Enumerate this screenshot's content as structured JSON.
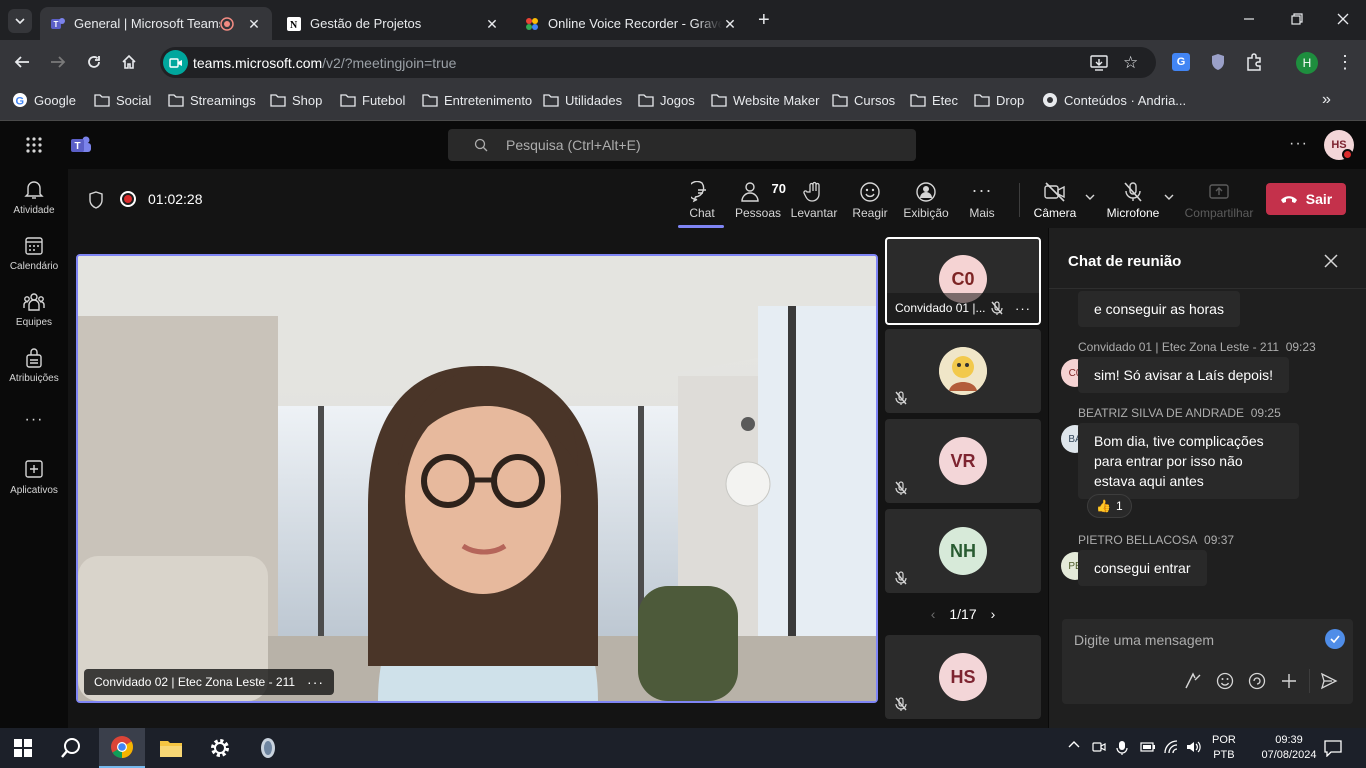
{
  "browser": {
    "tabs": [
      {
        "title": "General | Microsoft Teams",
        "icon": "teams-favicon",
        "active": true,
        "recording": true
      },
      {
        "title": "Gestão de Projetos",
        "icon": "notion-favicon",
        "active": false
      },
      {
        "title": "Online Voice Recorder - Grave o",
        "icon": "recorder-favicon",
        "active": false
      }
    ],
    "url_host": "teams.microsoft.com",
    "url_path": "/v2/?meetingjoin=true",
    "profile_initial": "H",
    "bookmarks": [
      "Google",
      "Social",
      "Streamings",
      "Shop",
      "Futebol",
      "Entretenimento",
      "Utilidades",
      "Jogos",
      "Website Maker",
      "Cursos",
      "Etec",
      "Drop",
      "Conteúdos · Andria..."
    ]
  },
  "teams": {
    "search_placeholder": "Pesquisa (Ctrl+Alt+E)",
    "user_initials": "HS",
    "rail": [
      {
        "label": "Atividade",
        "icon": "bell-icon"
      },
      {
        "label": "Calendário",
        "icon": "calendar-icon"
      },
      {
        "label": "Equipes",
        "icon": "teams-icon"
      },
      {
        "label": "Atribuições",
        "icon": "assignments-icon"
      },
      {
        "label": "Aplicativos",
        "icon": "add-apps-icon"
      }
    ]
  },
  "meeting": {
    "timer": "01:02:28",
    "people_count": "70",
    "controls": {
      "chat": "Chat",
      "people": "Pessoas",
      "raise": "Levantar",
      "react": "Reagir",
      "view": "Exibição",
      "more": "Mais",
      "camera": "Câmera",
      "mic": "Microfone",
      "share": "Compartilhar",
      "leave": "Sair"
    },
    "main_speaker": "Convidado 02 | Etec Zona Leste - 211",
    "gallery": [
      {
        "initials": "C0",
        "name": "Convidado 01 |...",
        "color": "#f5d3d3",
        "text_color": "#7d2424"
      },
      {
        "initials": "",
        "name": "",
        "color": "#e6d9b8"
      },
      {
        "initials": "VR",
        "name": "",
        "color": "#f3d6d8",
        "text_color": "#7d2430"
      },
      {
        "initials": "NH",
        "name": "",
        "color": "#d7ead9",
        "text_color": "#285b31"
      },
      {
        "initials": "HS",
        "name": "",
        "color": "#f3d6d8",
        "text_color": "#7d2430"
      }
    ],
    "pager": "1/17"
  },
  "chat": {
    "title": "Chat de reunião",
    "messages": [
      {
        "author": "",
        "time": "",
        "text": "e conseguir as horas",
        "initials": ""
      },
      {
        "author": "Convidado 01 | Etec Zona Leste - 211",
        "time": "09:23",
        "text": "sim! Só avisar a Laís depois!",
        "initials": "C0"
      },
      {
        "author": "BEATRIZ SILVA DE ANDRADE",
        "time": "09:25",
        "text": "Bom dia, tive complicações para entrar por isso não estava aqui antes",
        "initials": "BA",
        "reaction": "👍",
        "reaction_count": "1"
      },
      {
        "author": "PIETRO BELLACOSA",
        "time": "09:37",
        "text": "consegui entrar",
        "initials": "PB"
      }
    ],
    "input_placeholder": "Digite uma mensagem"
  },
  "taskbar": {
    "lang_line1": "POR",
    "lang_line2": "PTB",
    "time": "09:39",
    "date": "07/08/2024"
  },
  "colors": {
    "accent": "#7f85f5",
    "leave": "#c4314b",
    "record": "#d92c2c"
  }
}
